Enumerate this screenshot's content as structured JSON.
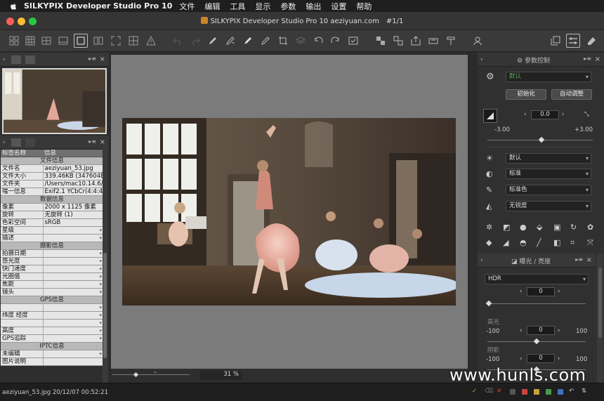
{
  "menubar": {
    "app": "SILKYPIX Developer Studio Pro 10",
    "items": [
      "文件",
      "编辑",
      "工具",
      "显示",
      "参数",
      "输出",
      "设置",
      "帮助"
    ]
  },
  "window": {
    "title": "SILKYPIX Developer Studio Pro 10 aeziyuan.com",
    "page": "#1/1"
  },
  "info_panel": {
    "col_tag": "标签名称",
    "col_info": "信息",
    "rows": [
      {
        "type": "sec",
        "label": "文件信息"
      },
      {
        "type": "row",
        "k": "文件名",
        "v": "aeziyuan_53.jpg"
      },
      {
        "type": "row",
        "k": "文件大小",
        "v": "339.46KB (347604B"
      },
      {
        "type": "row",
        "k": "文件夹",
        "v": "/Users/mac10.14.6/D"
      },
      {
        "type": "row",
        "k": "嗤一信息",
        "v": "Exif2.1 YCbCr(4:4:4"
      },
      {
        "type": "sec",
        "label": "数据信息"
      },
      {
        "type": "row",
        "k": "像素",
        "v": "2000 x 1125 像素"
      },
      {
        "type": "row",
        "k": "旋转",
        "v": "无旋转 (1)"
      },
      {
        "type": "row",
        "k": "色彩空间",
        "v": "sRGB"
      },
      {
        "type": "row",
        "k": "星级",
        "v": "",
        "dd": true
      },
      {
        "type": "row",
        "k": "描述",
        "v": "",
        "dd": true
      },
      {
        "type": "sec",
        "label": "摄影信息"
      },
      {
        "type": "row",
        "k": "拍摄日期",
        "v": "",
        "dd": true
      },
      {
        "type": "row",
        "k": "感光度",
        "v": "",
        "dd": true
      },
      {
        "type": "row",
        "k": "快门速度",
        "v": "",
        "dd": true
      },
      {
        "type": "row",
        "k": "光圈值",
        "v": "",
        "dd": true
      },
      {
        "type": "row",
        "k": "焦距",
        "v": "",
        "dd": true
      },
      {
        "type": "row",
        "k": "镜头",
        "v": "",
        "dd": true
      },
      {
        "type": "sec",
        "label": "GPS信息"
      },
      {
        "type": "row",
        "k": "",
        "v": "",
        "dd": true
      },
      {
        "type": "row",
        "k": "纬度 经度",
        "v": "",
        "dd": true
      },
      {
        "type": "row",
        "k": "",
        "v": "",
        "dd": true
      },
      {
        "type": "row",
        "k": "高度",
        "v": "",
        "dd": true
      },
      {
        "type": "row",
        "k": "GPS追踪",
        "v": "",
        "dd": true
      },
      {
        "type": "sec",
        "label": "IPTC信息"
      },
      {
        "type": "row",
        "k": "未编辑",
        "v": "",
        "dd": true
      },
      {
        "type": "row",
        "k": "图片说明",
        "v": ""
      }
    ]
  },
  "center": {
    "zoom": "31 %"
  },
  "params": {
    "header": "参数控制",
    "preset": "默认",
    "init_btn": "初始化",
    "auto_btn": "自动调整",
    "exposure_value": "0.0",
    "exposure_min": "-3.00",
    "exposure_max": "+3.00",
    "white_balance": "默认",
    "tone": "标准",
    "color": "标准色",
    "sharpness": "无锐度"
  },
  "exposure_panel": {
    "header": "曝光 / 亮度",
    "mode": "HDR",
    "hdr_value": "0",
    "highlight_label": "高光",
    "highlight_min": "-100",
    "highlight_value": "0",
    "highlight_max": "100",
    "shadow_label": "阴影",
    "shadow_min": "-100",
    "shadow_value": "0",
    "shadow_max": "100"
  },
  "status": {
    "text": "aeziyuan_53.jpg 20/12/07 00:52:21"
  },
  "watermark": "www.hunls.com"
}
